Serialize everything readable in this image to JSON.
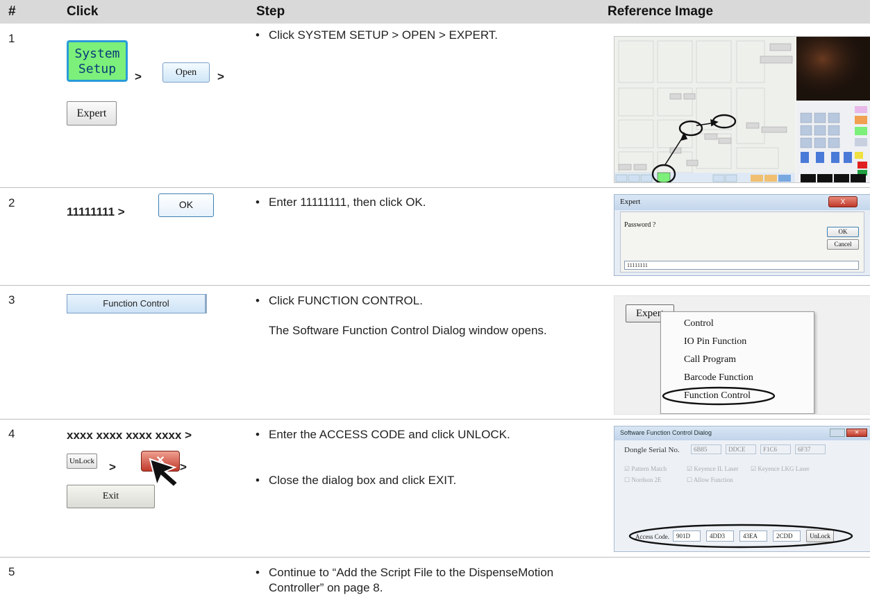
{
  "header": {
    "num": "#",
    "click": "Click",
    "step": "Step",
    "ref": "Reference Image"
  },
  "rows": [
    {
      "num": "1",
      "click": {
        "system_setup": "System\nSetup",
        "gt1": ">",
        "open": "Open",
        "gt2": ">",
        "expert": "Expert"
      },
      "step": [
        "Click SYSTEM SETUP > OPEN > EXPERT."
      ]
    },
    {
      "num": "2",
      "click": {
        "code": "11111111 >",
        "ok": "OK"
      },
      "step": [
        "Enter 11111111, then click OK."
      ],
      "ref": {
        "title": "Expert",
        "close": "X",
        "prompt": "Password ?",
        "ok": "OK",
        "cancel": "Cancel",
        "value": "11111111"
      }
    },
    {
      "num": "3",
      "click": {
        "function_control": "Function Control"
      },
      "step": [
        "Click FUNCTION CONTROL."
      ],
      "note": "The Software Function Control Dialog window opens.",
      "ref": {
        "button": "Expert",
        "menu": [
          "Control",
          "IO Pin Function",
          "Call Program",
          "Barcode Function",
          "Function Control"
        ]
      }
    },
    {
      "num": "4",
      "click": {
        "code": "xxxx xxxx xxxx xxxx >",
        "unlock": "UnLock",
        "gt1": ">",
        "gt2": ">",
        "exit": "Exit"
      },
      "step": [
        "Enter the ACCESS CODE and click UNLOCK.",
        "Close the dialog box and click EXIT."
      ],
      "ref": {
        "title": "Software Function Control Dialog",
        "dongle_label": "Dongle Serial No.",
        "dongle": [
          "6B85",
          "DDCE",
          "F1C6",
          "6F37"
        ],
        "checks": [
          "Pattern Match",
          "Keyence IL Laser",
          "Keyence LKG Laser",
          "Nordson 2E",
          "Allow Function"
        ],
        "access_label": "Access Code.",
        "access": [
          "901D",
          "4DD3",
          "43EA",
          "2CDD"
        ],
        "unlock": "UnLock"
      }
    },
    {
      "num": "5",
      "step": [
        "Continue to “Add the Script File to the DispenseMotion Controller” on page 8."
      ]
    }
  ],
  "colors": {
    "header_bg": "#d9d9d9",
    "green_button": "#7cf07a",
    "dialog_bg": "#eef2f7",
    "oval": "#111111"
  }
}
